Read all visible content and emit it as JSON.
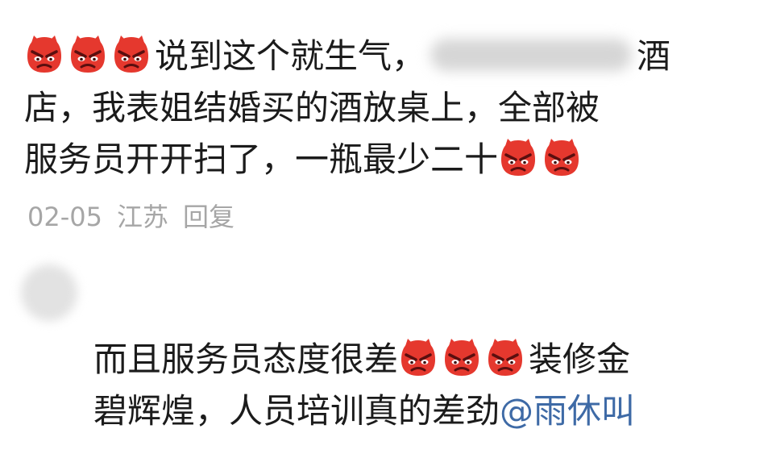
{
  "comment1": {
    "line1_text": "说到这个就生气，",
    "line1_end": "酒",
    "line2": "店，我表姐结婚买的酒放桌上，全部被",
    "line3": "服务员开开扫了，一瓶最少二十",
    "date": "02-05",
    "location": "江苏",
    "reply_label": "回复"
  },
  "comment2": {
    "line1_before": "而且服务员态度很差",
    "line1_after": "装修金",
    "line2_text": "碧辉煌，人员培训真的差劲",
    "mention": "@雨休叫"
  },
  "icons": {
    "emoji": "angry-devil-emoji"
  },
  "colors": {
    "text": "#1b1b1b",
    "meta": "#a6a6a6",
    "mention": "#3e6aa6",
    "emoji": "#e5382e"
  }
}
